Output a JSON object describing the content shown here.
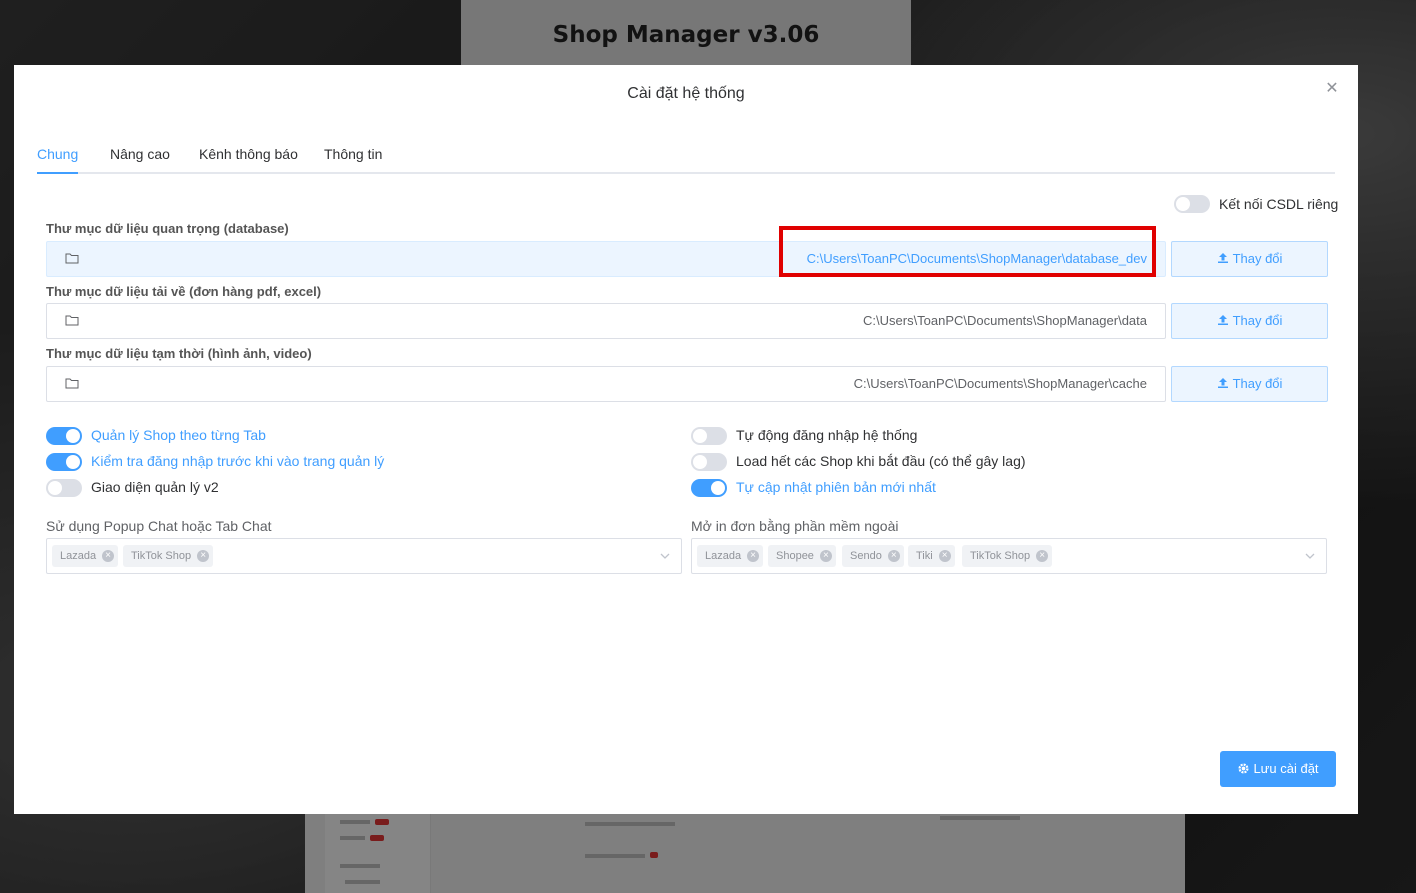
{
  "background": {
    "app_title": "Shop Manager v3.06"
  },
  "modal": {
    "title": "Cài đặt hệ thống",
    "close_icon": "close-icon",
    "tabs": [
      {
        "label": "Chung",
        "active": true
      },
      {
        "label": "Nâng cao",
        "active": false
      },
      {
        "label": "Kênh thông báo",
        "active": false
      },
      {
        "label": "Thông tin",
        "active": false
      }
    ],
    "private_db": {
      "label": "Kết nối CSDL riêng",
      "on": false
    },
    "folders": [
      {
        "label": "Thư mục dữ liệu quan trọng (database)",
        "path": "C:\\Users\\ToanPC\\Documents\\ShopManager\\database_dev",
        "button": "Thay đổi",
        "highlighted": true
      },
      {
        "label": "Thư mục dữ liệu tải về (đơn hàng pdf, excel)",
        "path": "C:\\Users\\ToanPC\\Documents\\ShopManager\\data",
        "button": "Thay đổi",
        "highlighted": false
      },
      {
        "label": "Thư mục dữ liệu tạm thời (hình ảnh, video)",
        "path": "C:\\Users\\ToanPC\\Documents\\ShopManager\\cache",
        "button": "Thay đổi",
        "highlighted": false
      }
    ],
    "options_left": [
      {
        "label": "Quản lý Shop theo từng Tab",
        "on": true
      },
      {
        "label": "Kiểm tra đăng nhập trước khi vào trang quản lý",
        "on": true
      },
      {
        "label": "Giao diện quản lý v2",
        "on": false
      }
    ],
    "options_right": [
      {
        "label": "Tự động đăng nhập hệ thống",
        "on": false
      },
      {
        "label": "Load hết các Shop khi bắt đầu (có thể gây lag)",
        "on": false
      },
      {
        "label": "Tự cập nhật phiên bản mới nhất",
        "on": true
      }
    ],
    "popup_chat": {
      "label": "Sử dụng Popup Chat hoặc Tab Chat",
      "tags": [
        "Lazada",
        "TikTok Shop"
      ]
    },
    "external_print": {
      "label": "Mở in đơn bằng phần mềm ngoài",
      "tags": [
        "Lazada",
        "Shopee",
        "Sendo",
        "Tiki",
        "TikTok Shop"
      ]
    },
    "save_label": "Lưu cài đặt"
  },
  "colors": {
    "accent": "#409eff",
    "highlight_box": "#e00000"
  }
}
